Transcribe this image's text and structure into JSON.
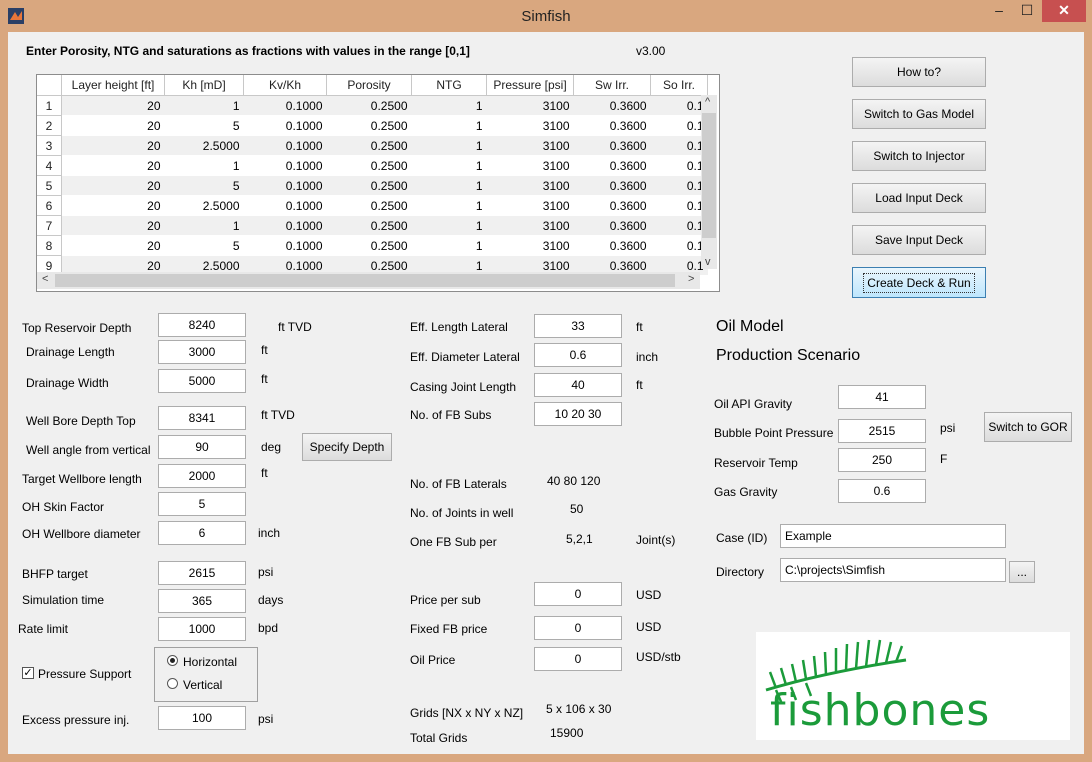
{
  "window": {
    "title": "Simfish",
    "min_glyph": "–",
    "max_glyph": "☐",
    "close_glyph": "✕",
    "app_icon": "matlab-icon"
  },
  "header": {
    "instruction": "Enter Porosity, NTG and saturations as fractions with values in the range [0,1]",
    "version": "v3.00"
  },
  "table": {
    "columns": [
      "Layer height [ft]",
      "Kh [mD]",
      "Kv/Kh",
      "Porosity",
      "NTG",
      "Pressure [psi]",
      "Sw Irr.",
      "So Irr."
    ],
    "rows": [
      [
        "1",
        "20",
        "1",
        "0.1000",
        "0.2500",
        "1",
        "3100",
        "0.3600",
        "0.1"
      ],
      [
        "2",
        "20",
        "5",
        "0.1000",
        "0.2500",
        "1",
        "3100",
        "0.3600",
        "0.1"
      ],
      [
        "3",
        "20",
        "2.5000",
        "0.1000",
        "0.2500",
        "1",
        "3100",
        "0.3600",
        "0.1"
      ],
      [
        "4",
        "20",
        "1",
        "0.1000",
        "0.2500",
        "1",
        "3100",
        "0.3600",
        "0.1"
      ],
      [
        "5",
        "20",
        "5",
        "0.1000",
        "0.2500",
        "1",
        "3100",
        "0.3600",
        "0.1"
      ],
      [
        "6",
        "20",
        "2.5000",
        "0.1000",
        "0.2500",
        "1",
        "3100",
        "0.3600",
        "0.1"
      ],
      [
        "7",
        "20",
        "1",
        "0.1000",
        "0.2500",
        "1",
        "3100",
        "0.3600",
        "0.1"
      ],
      [
        "8",
        "20",
        "5",
        "0.1000",
        "0.2500",
        "1",
        "3100",
        "0.3600",
        "0.1"
      ],
      [
        "9",
        "20",
        "2.5000",
        "0.1000",
        "0.2500",
        "1",
        "3100",
        "0.3600",
        "0.1"
      ]
    ],
    "scroll_up": "^",
    "scroll_down": "v",
    "scroll_left": "<",
    "scroll_right": ">"
  },
  "buttons": {
    "how_to": "How to?",
    "switch_gas": "Switch to Gas Model",
    "switch_injector": "Switch to Injector",
    "load_deck": "Load Input Deck",
    "save_deck": "Save Input Deck",
    "create_run": "Create Deck & Run",
    "specify_depth": "Specify Depth",
    "switch_gor": "Switch to GOR",
    "browse": "..."
  },
  "left_params": {
    "top_depth": {
      "label": "Top Reservoir Depth",
      "value": "8240",
      "unit": "ft TVD"
    },
    "drainage_length": {
      "label": "Drainage Length",
      "value": "3000",
      "unit": "ft"
    },
    "drainage_width": {
      "label": "Drainage Width",
      "value": "5000",
      "unit": "ft"
    },
    "wellbore_top": {
      "label": "Well Bore Depth Top",
      "value": "8341",
      "unit": "ft TVD"
    },
    "well_angle": {
      "label": "Well angle from vertical",
      "value": "90",
      "unit": "deg"
    },
    "target_length": {
      "label": "Target Wellbore length",
      "value": "2000",
      "unit": "ft"
    },
    "skin": {
      "label": "OH Skin Factor",
      "value": "5",
      "unit": ""
    },
    "wellbore_diam": {
      "label": "OH Wellbore diameter",
      "value": "6",
      "unit": "inch"
    },
    "bhfp": {
      "label": "BHFP target",
      "value": "2615",
      "unit": "psi"
    },
    "sim_time": {
      "label": "Simulation time",
      "value": "365",
      "unit": "days"
    },
    "rate_limit": {
      "label": "Rate limit",
      "value": "1000",
      "unit": "bpd"
    },
    "excess_pressure": {
      "label": "Excess pressure inj.",
      "value": "100",
      "unit": "psi"
    }
  },
  "pressure_support": {
    "label": "Pressure Support",
    "checked": true,
    "check_glyph": "✓",
    "horizontal": "Horizontal",
    "vertical": "Vertical"
  },
  "mid_params": {
    "eff_length": {
      "label": "Eff. Length Lateral",
      "value": "33",
      "unit": "ft"
    },
    "eff_diam": {
      "label": "Eff. Diameter Lateral",
      "value": "0.6",
      "unit": "inch"
    },
    "casing_joint": {
      "label": "Casing Joint Length",
      "value": "40",
      "unit": "ft"
    },
    "fb_subs": {
      "label": "No. of FB Subs",
      "value": "10  20  30"
    },
    "fb_laterals": {
      "label": "No. of FB Laterals",
      "value": "40  80  120"
    },
    "joints": {
      "label": "No. of Joints in well",
      "value": "50"
    },
    "fb_sub_per": {
      "label": "One FB Sub per",
      "value": "5,2,1",
      "unit": "Joint(s)"
    },
    "price_sub": {
      "label": "Price per sub",
      "value": "0",
      "unit": "USD"
    },
    "fixed_price": {
      "label": "Fixed FB price",
      "value": "0",
      "unit": "USD"
    },
    "oil_price": {
      "label": "Oil Price",
      "value": "0",
      "unit": "USD/stb"
    },
    "grids": {
      "label": "Grids [NX x NY x NZ]",
      "value": "5 x 106 x 30"
    },
    "total_grids": {
      "label": "Total Grids",
      "value": "15900"
    }
  },
  "right_params": {
    "model": "Oil Model",
    "scenario": "Production Scenario",
    "api": {
      "label": "Oil API Gravity",
      "value": "41"
    },
    "bubble": {
      "label": "Bubble Point Pressure",
      "value": "2515",
      "unit": "psi"
    },
    "temp": {
      "label": "Reservoir Temp",
      "value": "250",
      "unit": "F"
    },
    "gas_gravity": {
      "label": "Gas Gravity",
      "value": "0.6"
    },
    "case": {
      "label": "Case (ID)",
      "value": "Example"
    },
    "directory": {
      "label": "Directory",
      "value": "C:\\projects\\Simfish"
    }
  },
  "logo": {
    "text": "fishbones",
    "icon": "fishbones-logo-icon",
    "color": "#1b9b3a"
  }
}
